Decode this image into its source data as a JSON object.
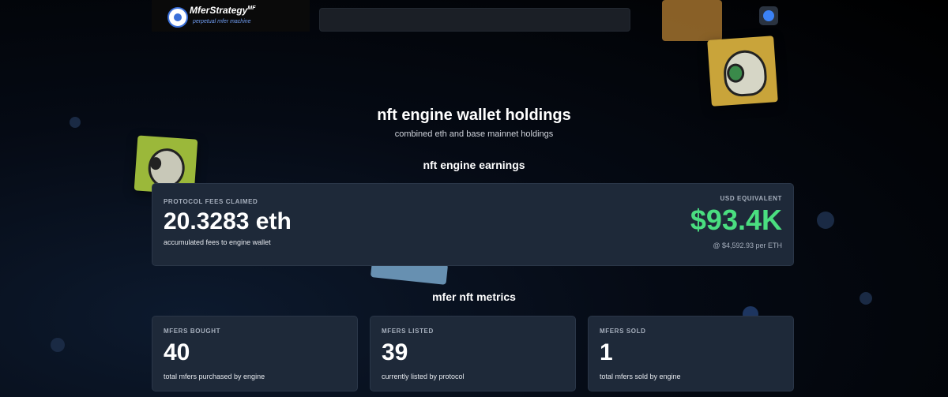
{
  "header": {
    "brand_name": "MferStrategy",
    "brand_sup": "MF",
    "brand_tagline": "perpetual mfer machine"
  },
  "holdings": {
    "title": "nft engine wallet holdings",
    "subtitle": "combined eth and base mainnet holdings"
  },
  "earnings": {
    "section_title": "nft engine earnings",
    "fees_label": "PROTOCOL FEES CLAIMED",
    "fees_value": "20.3283 eth",
    "fees_desc": "accumulated fees to engine wallet",
    "usd_label": "USD EQUIVALENT",
    "usd_value": "$93.4K",
    "usd_rate": "@ $4,592.93 per ETH"
  },
  "metrics": {
    "section_title": "mfer nft metrics",
    "cards": [
      {
        "label": "MFERS BOUGHT",
        "value": "40",
        "desc": "total mfers purchased by engine"
      },
      {
        "label": "MFERS LISTED",
        "value": "39",
        "desc": "currently listed by protocol"
      },
      {
        "label": "MFERS SOLD",
        "value": "1",
        "desc": "total mfers sold by engine"
      }
    ]
  },
  "colors": {
    "accent_green": "#4ade80",
    "card_bg": "#1e2939",
    "wallet_blue": "#3b82f6"
  },
  "icons": [
    "logo-icon",
    "wallet-icon"
  ]
}
